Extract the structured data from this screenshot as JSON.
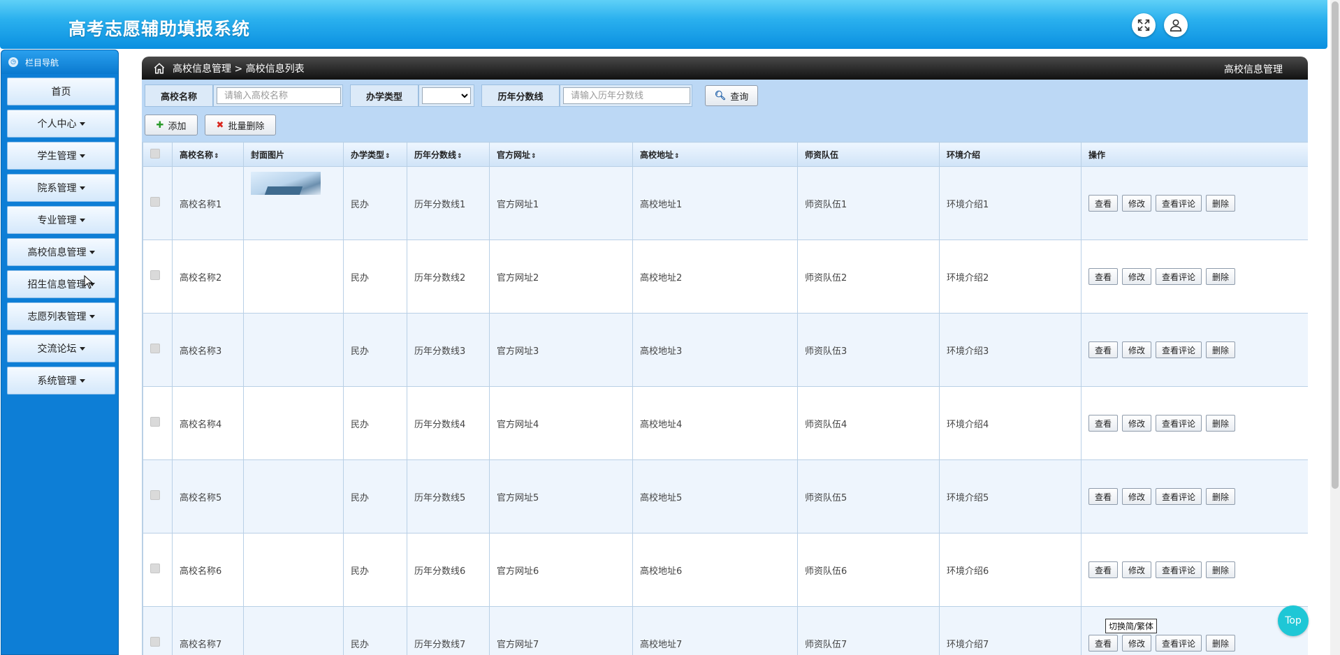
{
  "header": {
    "title": "高考志愿辅助填报系统",
    "fullscreen_icon": "fullscreen-icon",
    "user_icon": "user-icon"
  },
  "sidebar": {
    "title": "栏目导航",
    "items": [
      {
        "label": "首页",
        "dropdown": false
      },
      {
        "label": "个人中心",
        "dropdown": true
      },
      {
        "label": "学生管理",
        "dropdown": true
      },
      {
        "label": "院系管理",
        "dropdown": true
      },
      {
        "label": "专业管理",
        "dropdown": true
      },
      {
        "label": "高校信息管理",
        "dropdown": true
      },
      {
        "label": "招生信息管理",
        "dropdown": true
      },
      {
        "label": "志愿列表管理",
        "dropdown": true
      },
      {
        "label": "交流论坛",
        "dropdown": true
      },
      {
        "label": "系统管理",
        "dropdown": true
      }
    ]
  },
  "breadcrumb": {
    "path": "高校信息管理 > 高校信息列表",
    "right": "高校信息管理"
  },
  "search": {
    "name_label": "高校名称",
    "name_placeholder": "请输入高校名称",
    "type_label": "办学类型",
    "type_value": "",
    "score_label": "历年分数线",
    "score_placeholder": "请输入历年分数线",
    "query_label": "查询"
  },
  "actions": {
    "add_label": "添加",
    "batch_delete_label": "批量删除"
  },
  "table": {
    "columns": [
      "高校名称",
      "封面图片",
      "办学类型",
      "历年分数线",
      "官方网址",
      "高校地址",
      "师资队伍",
      "环境介绍",
      "操作"
    ],
    "sortable": [
      true,
      false,
      true,
      true,
      true,
      true,
      false,
      false,
      false
    ],
    "op_labels": [
      "查看",
      "修改",
      "查看评论",
      "删除"
    ],
    "rows": [
      {
        "name": "高校名称1",
        "type": "民办",
        "score": "历年分数线1",
        "url": "官方网址1",
        "address": "高校地址1",
        "faculty": "师资队伍1",
        "env": "环境介绍1",
        "has_cover": true
      },
      {
        "name": "高校名称2",
        "type": "民办",
        "score": "历年分数线2",
        "url": "官方网址2",
        "address": "高校地址2",
        "faculty": "师资队伍2",
        "env": "环境介绍2",
        "has_cover": false
      },
      {
        "name": "高校名称3",
        "type": "民办",
        "score": "历年分数线3",
        "url": "官方网址3",
        "address": "高校地址3",
        "faculty": "师资队伍3",
        "env": "环境介绍3",
        "has_cover": false
      },
      {
        "name": "高校名称4",
        "type": "民办",
        "score": "历年分数线4",
        "url": "官方网址4",
        "address": "高校地址4",
        "faculty": "师资队伍4",
        "env": "环境介绍4",
        "has_cover": false
      },
      {
        "name": "高校名称5",
        "type": "民办",
        "score": "历年分数线5",
        "url": "官方网址5",
        "address": "高校地址5",
        "faculty": "师资队伍5",
        "env": "环境介绍5",
        "has_cover": false
      },
      {
        "name": "高校名称6",
        "type": "民办",
        "score": "历年分数线6",
        "url": "官方网址6",
        "address": "高校地址6",
        "faculty": "师资队伍6",
        "env": "环境介绍6",
        "has_cover": false
      },
      {
        "name": "高校名称7",
        "type": "民办",
        "score": "历年分数线7",
        "url": "官方网址7",
        "address": "高校地址7",
        "faculty": "师资队伍7",
        "env": "环境介绍7",
        "has_cover": false
      }
    ]
  },
  "floating": {
    "top_label": "Top",
    "tooltip": "切换简/繁体"
  },
  "colors": {
    "header": "#1aa4ea",
    "sidebar": "#0d7ed6",
    "search_panel": "#bcd8f5",
    "crumb_bar": "#1a1a1a",
    "top_button": "#1ec7d6"
  }
}
